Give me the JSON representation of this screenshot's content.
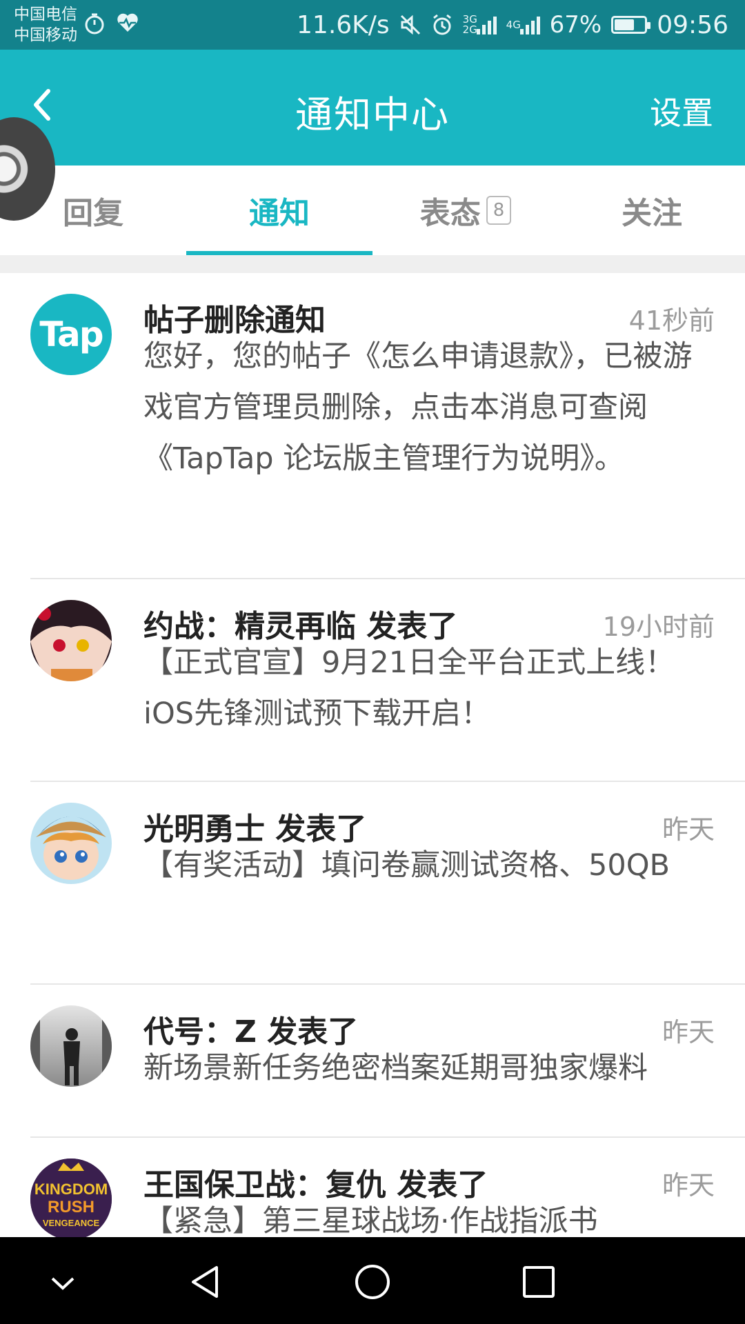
{
  "status_bar": {
    "carrier1": "中国电信",
    "carrier2": "中国移动",
    "speed": "11.6K/s",
    "net1": "3G",
    "net1b": "2G",
    "net2": "4G",
    "battery": "67%",
    "battery_level": 0.67,
    "time": "09:56"
  },
  "header": {
    "title": "通知中心",
    "settings_label": "设置"
  },
  "tabs": [
    {
      "label": "回复"
    },
    {
      "label": "通知",
      "active": true
    },
    {
      "label": "表态",
      "badge": "8"
    },
    {
      "label": "关注"
    }
  ],
  "notifications": [
    {
      "title": "帖子删除通知",
      "time": "41秒前",
      "avatar_text": "Tap",
      "body": "您好，您的帖子《怎么申请退款》，已被游戏官方管理员删除，点击本消息可查阅《TapTap 论坛版主管理行为说明》。"
    },
    {
      "title": "约战：精灵再临 发表了",
      "time": "19小时前",
      "body": "【正式官宣】9月21日全平台正式上线！iOS先锋测试预下载开启！"
    },
    {
      "title": "光明勇士 发表了",
      "time": "昨天",
      "body": "【有奖活动】填问卷赢测试资格、50QB"
    },
    {
      "title": "代号：Z 发表了",
      "time": "昨天",
      "body": "新场景新任务绝密档案延期哥独家爆料"
    },
    {
      "title": "王国保卫战：复仇 发表了",
      "time": "昨天",
      "avatar_line1": "KINGDOM",
      "avatar_line2": "RUSH",
      "avatar_line3": "VENGEANCE",
      "body": "【紧急】第三星球战场·作战指派书"
    }
  ],
  "colors": {
    "accent": "#19b7c3",
    "status_bar": "#13828c"
  }
}
